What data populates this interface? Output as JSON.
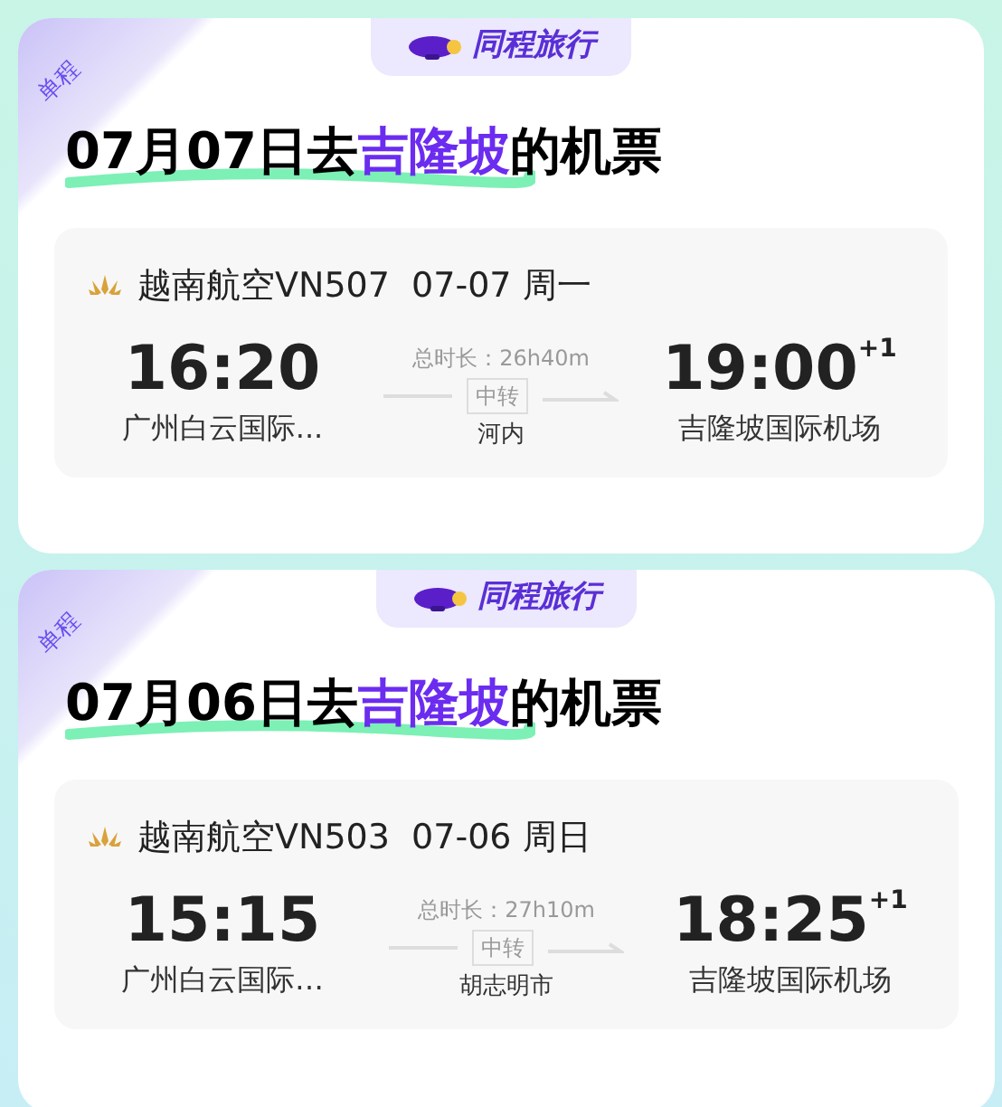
{
  "tickets": [
    {
      "corner_tag": "单程",
      "brand": "同程旅行",
      "title_prefix": "07月07日去",
      "destination": "吉隆坡",
      "title_suffix": "的机票",
      "flight": "越南航空VN507  07-07 周一",
      "depart_time": "16:20",
      "depart_airport": "广州白云国际...",
      "duration": "总时长：26h40m",
      "transfer_tag": "中转",
      "transfer_city": "河内",
      "arrive_time": "19:00",
      "day_offset": "+1",
      "arrive_airport": "吉隆坡国际机场"
    },
    {
      "corner_tag": "单程",
      "brand": "同程旅行",
      "title_prefix": "07月06日去",
      "destination": "吉隆坡",
      "title_suffix": "的机票",
      "flight": "越南航空VN503  07-06 周日",
      "depart_time": "15:15",
      "depart_airport": "广州白云国际…",
      "duration": "总时长：27h10m",
      "transfer_tag": "中转",
      "transfer_city": "胡志明市",
      "arrive_time": "18:25",
      "day_offset": "+1",
      "arrive_airport": "吉隆坡国际机场"
    }
  ]
}
